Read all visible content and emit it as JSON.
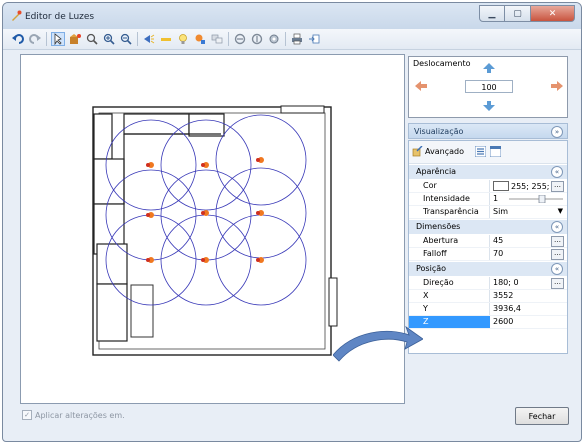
{
  "window": {
    "title": "Editor de Luzes"
  },
  "toolbar": {
    "icons": [
      "undo-icon",
      "redo-icon",
      "pointer-icon",
      "add-light-icon",
      "zoom-extents-icon",
      "zoom-in-icon",
      "zoom-out-icon",
      "light-spot-icon",
      "light-line-icon",
      "bulb-icon",
      "color-light-icon",
      "layers-icon",
      "group-icon",
      "ungroup-icon",
      "settings-icon",
      "print-icon",
      "export-icon"
    ]
  },
  "deslocamento": {
    "label": "Deslocamento",
    "value": "100"
  },
  "visualizacao": {
    "label": "Visualização"
  },
  "propgrid": {
    "avancado": "Avançado",
    "aparencia": {
      "label": "Aparência",
      "rows": [
        {
          "name": "Cor",
          "value": "255; 255; 255"
        },
        {
          "name": "Intensidade",
          "value": "1"
        },
        {
          "name": "Transparência",
          "value": "Sim"
        }
      ]
    },
    "dimensoes": {
      "label": "Dimensões",
      "rows": [
        {
          "name": "Abertura",
          "value": "45"
        },
        {
          "name": "Falloff",
          "value": "70"
        }
      ]
    },
    "posicao": {
      "label": "Posição",
      "rows": [
        {
          "name": "Direção",
          "value": "180; 0"
        },
        {
          "name": "X",
          "value": "3552"
        },
        {
          "name": "Y",
          "value": "3936,4"
        },
        {
          "name": "Z",
          "value": "2600"
        }
      ]
    }
  },
  "footer": {
    "apply_label": "Aplicar alterações em.",
    "close_label": "Fechar"
  },
  "colors": {
    "light_circle": "#3a3ab8",
    "selection": "#3399ff",
    "walls": "#222222"
  }
}
